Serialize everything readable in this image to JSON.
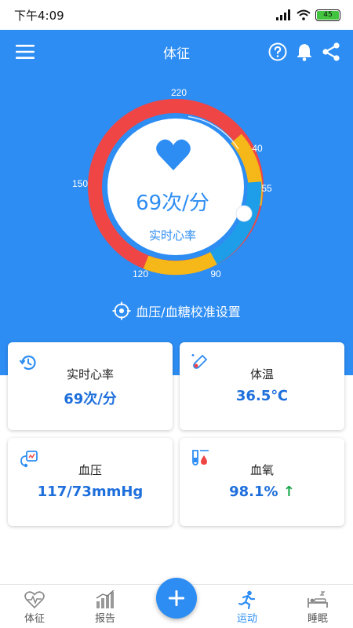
{
  "status_bar": {
    "time": "下午4:09",
    "battery": "45"
  },
  "header": {
    "title": "体征"
  },
  "gauge": {
    "value_text": "69次/分",
    "label": "实时心率",
    "ticks": [
      "220",
      "40",
      "55",
      "90",
      "120",
      "150"
    ]
  },
  "calibration": {
    "label": "血压/血糖校准设置"
  },
  "cards": [
    {
      "label": "实时心率",
      "value": "69次/分"
    },
    {
      "label": "体温",
      "value": "36.5℃"
    },
    {
      "label": "血压",
      "value": "117/73mmHg"
    },
    {
      "label": "血氧",
      "value": "98.1%",
      "trend": "↑"
    }
  ],
  "bottom_nav": [
    {
      "label": "体征"
    },
    {
      "label": "报告"
    },
    {
      "label": "运动"
    },
    {
      "label": "睡眠"
    }
  ],
  "colors": {
    "primary": "#2d8df3",
    "red": "#f04545",
    "yellow": "#f6b718",
    "blue_segment": "#1e9ee8",
    "trend_green": "#1aa84a"
  }
}
